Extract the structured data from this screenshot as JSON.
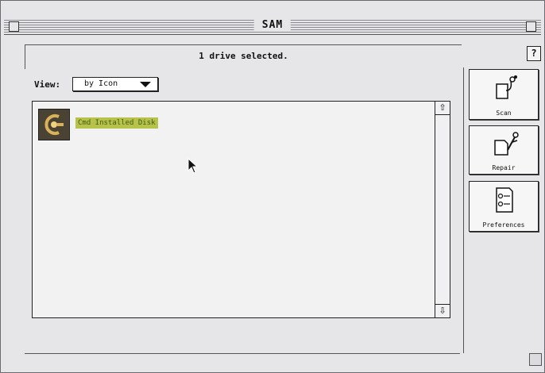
{
  "window": {
    "title": "SAM"
  },
  "status": {
    "text": "1 drive selected."
  },
  "help": {
    "label": "?"
  },
  "view": {
    "label": "View:",
    "selected": "by Icon"
  },
  "list": {
    "items": [
      {
        "label": "Cmd Installed Disk",
        "icon": "drive-icon"
      }
    ],
    "scroll_up_glyph": "⇧",
    "scroll_down_glyph": "⇩"
  },
  "toolbar": {
    "scan_label": "Scan",
    "repair_label": "Repair",
    "preferences_label": "Preferences"
  }
}
